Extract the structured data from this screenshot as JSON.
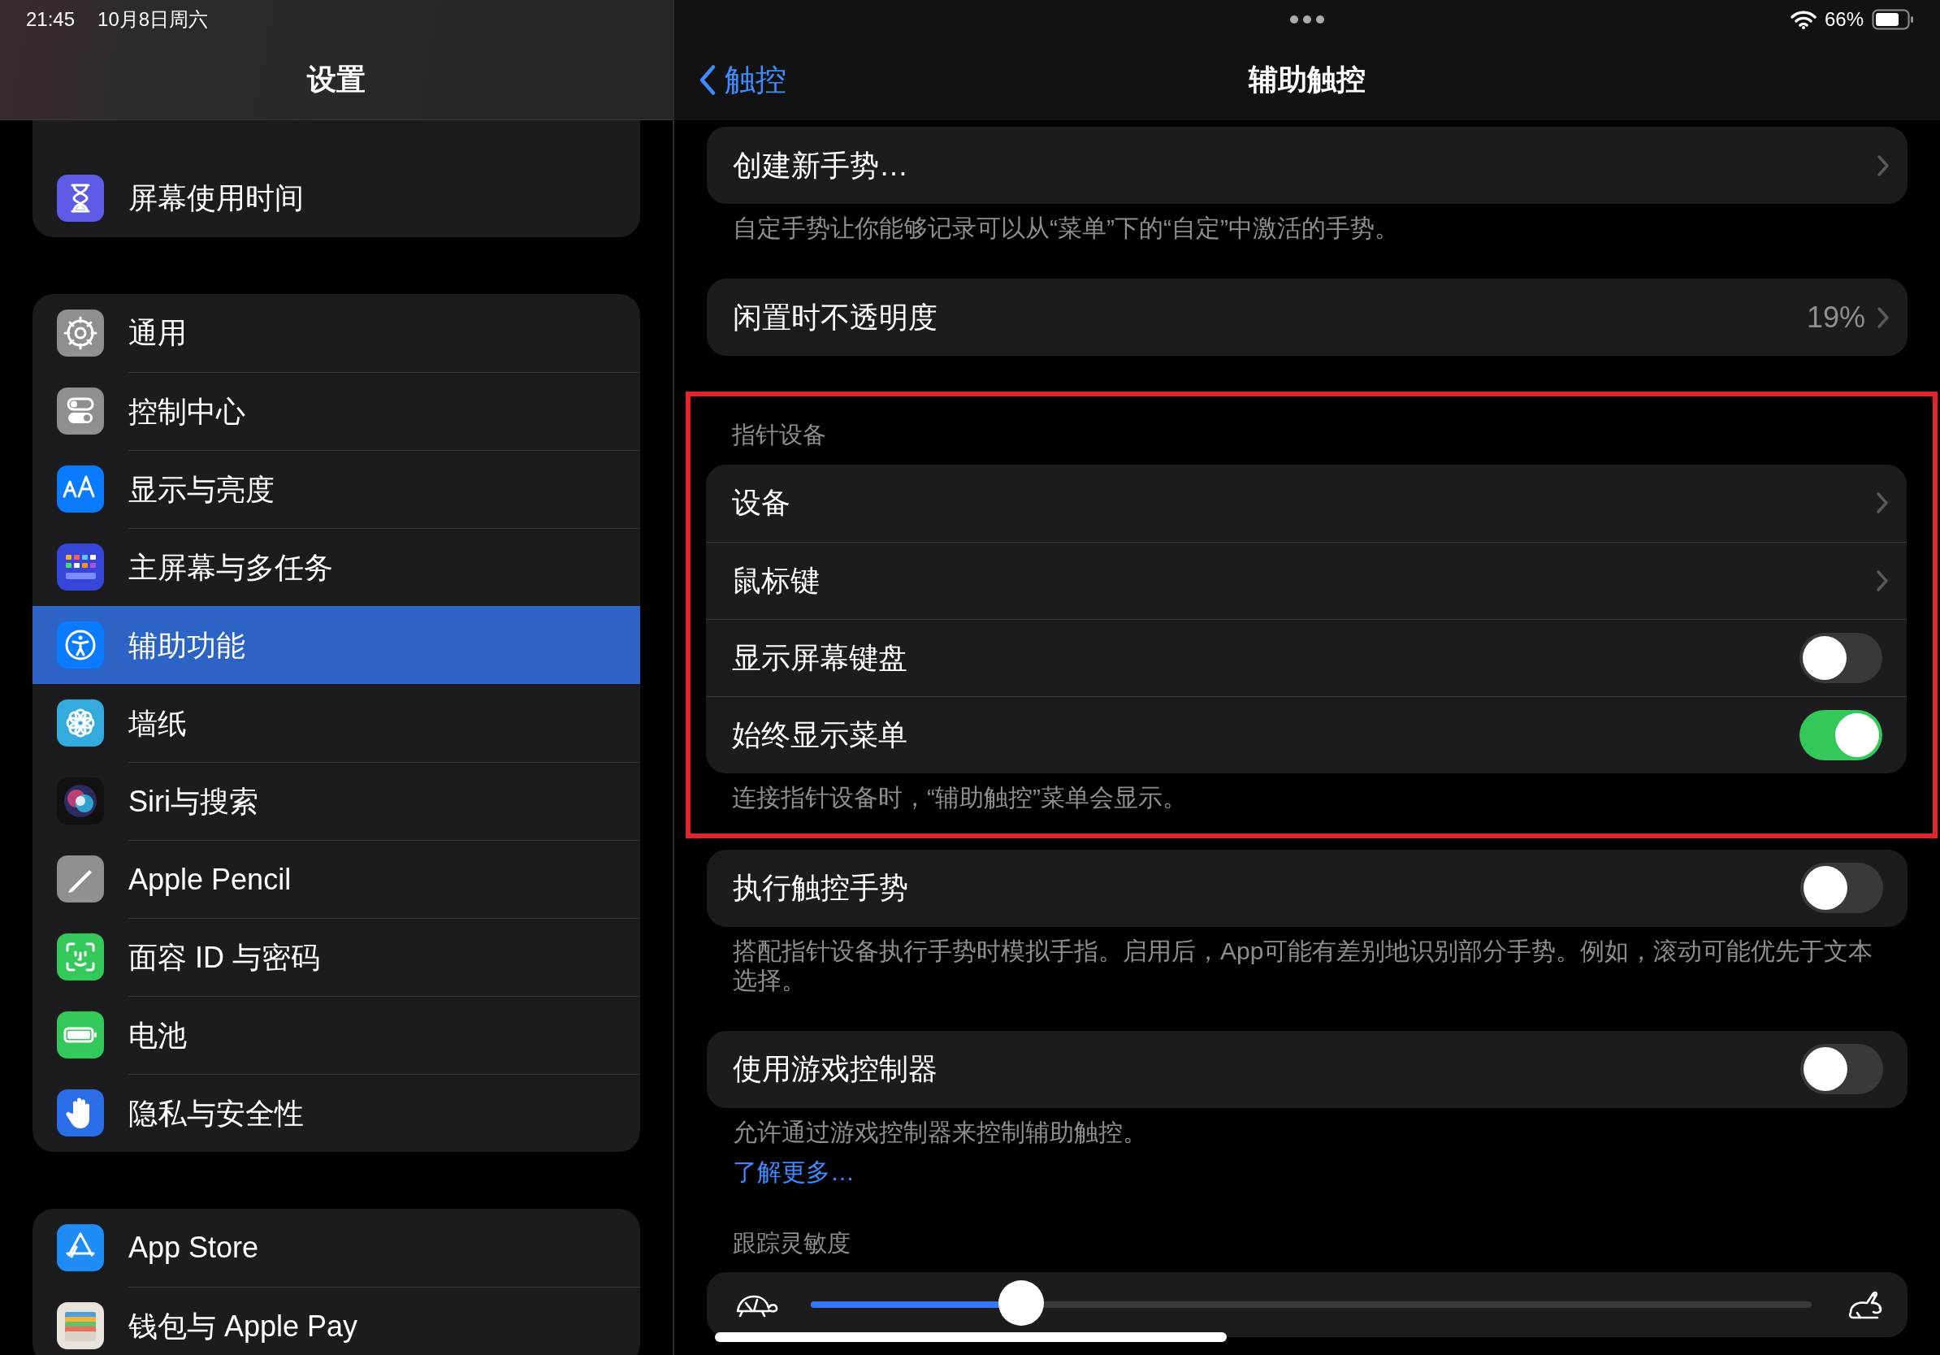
{
  "status_bar": {
    "time": "21:45",
    "date": "10月8日周六",
    "battery": "66%"
  },
  "sidebar": {
    "title": "设置",
    "groups": [
      {
        "items": [
          {
            "label": "屏幕使用时间",
            "selected": false
          }
        ]
      },
      {
        "items": [
          {
            "label": "通用",
            "selected": false
          },
          {
            "label": "控制中心",
            "selected": false
          },
          {
            "label": "显示与亮度",
            "selected": false
          },
          {
            "label": "主屏幕与多任务",
            "selected": false
          },
          {
            "label": "辅助功能",
            "selected": true
          },
          {
            "label": "墙纸",
            "selected": false
          },
          {
            "label": "Siri与搜索",
            "selected": false
          },
          {
            "label": "Apple Pencil",
            "selected": false
          },
          {
            "label": "面容 ID 与密码",
            "selected": false
          },
          {
            "label": "电池",
            "selected": false
          },
          {
            "label": "隐私与安全性",
            "selected": false
          }
        ]
      },
      {
        "items": [
          {
            "label": "App Store",
            "selected": false
          },
          {
            "label": "钱包与 Apple Pay",
            "selected": false
          }
        ]
      }
    ]
  },
  "detail": {
    "back": "触控",
    "title": "辅助触控",
    "sections": [
      {
        "rows": [
          {
            "kind": "link",
            "label": "创建新手势…"
          }
        ],
        "footer": "自定手势让你能够记录可以从“菜单”下的“自定”中激活的手势。"
      },
      {
        "rows": [
          {
            "kind": "link",
            "label": "闲置时不透明度",
            "value": "19%"
          }
        ]
      },
      {
        "header": "指针设备",
        "highlighted": true,
        "rows": [
          {
            "kind": "link",
            "label": "设备"
          },
          {
            "kind": "link",
            "label": "鼠标键"
          },
          {
            "kind": "toggle",
            "label": "显示屏幕键盘",
            "on": false
          },
          {
            "kind": "toggle",
            "label": "始终显示菜单",
            "on": true
          }
        ],
        "footer": "连接指针设备时，“辅助触控”菜单会显示。"
      },
      {
        "rows": [
          {
            "kind": "toggle",
            "label": "执行触控手势",
            "on": false
          }
        ],
        "footer": "搭配指针设备执行手势时模拟手指。启用后，App可能有差别地识别部分手势。例如，滚动可能优先于文本选择。"
      },
      {
        "rows": [
          {
            "kind": "toggle",
            "label": "使用游戏控制器",
            "on": false
          }
        ],
        "footer": "允许通过游戏控制器来控制辅助触控。",
        "link": "了解更多…"
      },
      {
        "header": "跟踪灵敏度",
        "rows": [
          {
            "kind": "slider",
            "level": 0.21
          }
        ]
      }
    ]
  }
}
